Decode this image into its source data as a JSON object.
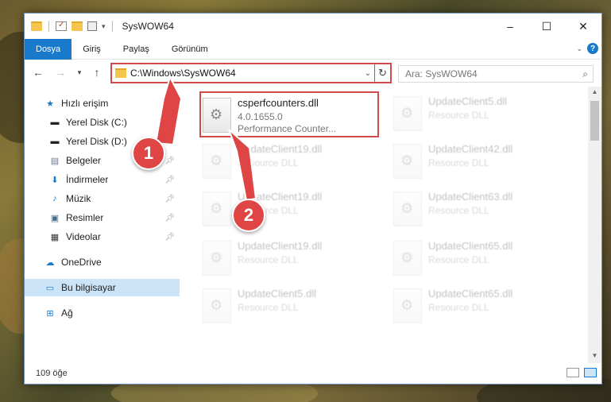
{
  "window": {
    "title": "SysWOW64",
    "minimize": "–",
    "maximize": "☐",
    "close": "✕"
  },
  "ribbon": {
    "tabs": [
      "Dosya",
      "Giriş",
      "Paylaş",
      "Görünüm"
    ],
    "help": "?"
  },
  "address": {
    "path": "C:\\Windows\\SysWOW64",
    "search_placeholder": "Ara: SysWOW64"
  },
  "nav": {
    "quick_access": "Hızlı erişim",
    "items": [
      {
        "label": "Yerel Disk (C:)",
        "pinned": true
      },
      {
        "label": "Yerel Disk (D:)",
        "pinned": true
      },
      {
        "label": "Belgeler",
        "pinned": true
      },
      {
        "label": "İndirmeler",
        "pinned": true
      },
      {
        "label": "Müzik",
        "pinned": true
      },
      {
        "label": "Resimler",
        "pinned": true
      },
      {
        "label": "Videolar",
        "pinned": true
      }
    ],
    "onedrive": "OneDrive",
    "this_pc": "Bu bilgisayar",
    "network": "Ağ"
  },
  "files": [
    {
      "name": "csperfcounters.dll",
      "line2": "4.0.1655.0",
      "line3": "Performance Counter..."
    },
    {
      "name": "UpdateClient5.dll",
      "line2": "Resource DLL"
    },
    {
      "name": "UpdateClient19.dll",
      "line2": "Resource DLL"
    },
    {
      "name": "UpdateClient42.dll",
      "line2": "Resource DLL"
    },
    {
      "name": "UpdateClient19.dll",
      "line2": "Resource DLL"
    },
    {
      "name": "UpdateClient63.dll",
      "line2": "Resource DLL"
    },
    {
      "name": "UpdateClient19.dll",
      "line2": "Resource DLL"
    },
    {
      "name": "UpdateClient65.dll",
      "line2": "Resource DLL"
    },
    {
      "name": "UpdateClient5.dll",
      "line2": "Resource DLL"
    },
    {
      "name": "UpdateClient65.dll",
      "line2": "Resource DLL"
    }
  ],
  "status": {
    "count": "109 öğe"
  },
  "annotations": {
    "badge1": "1",
    "badge2": "2",
    "color": "#e04545"
  }
}
